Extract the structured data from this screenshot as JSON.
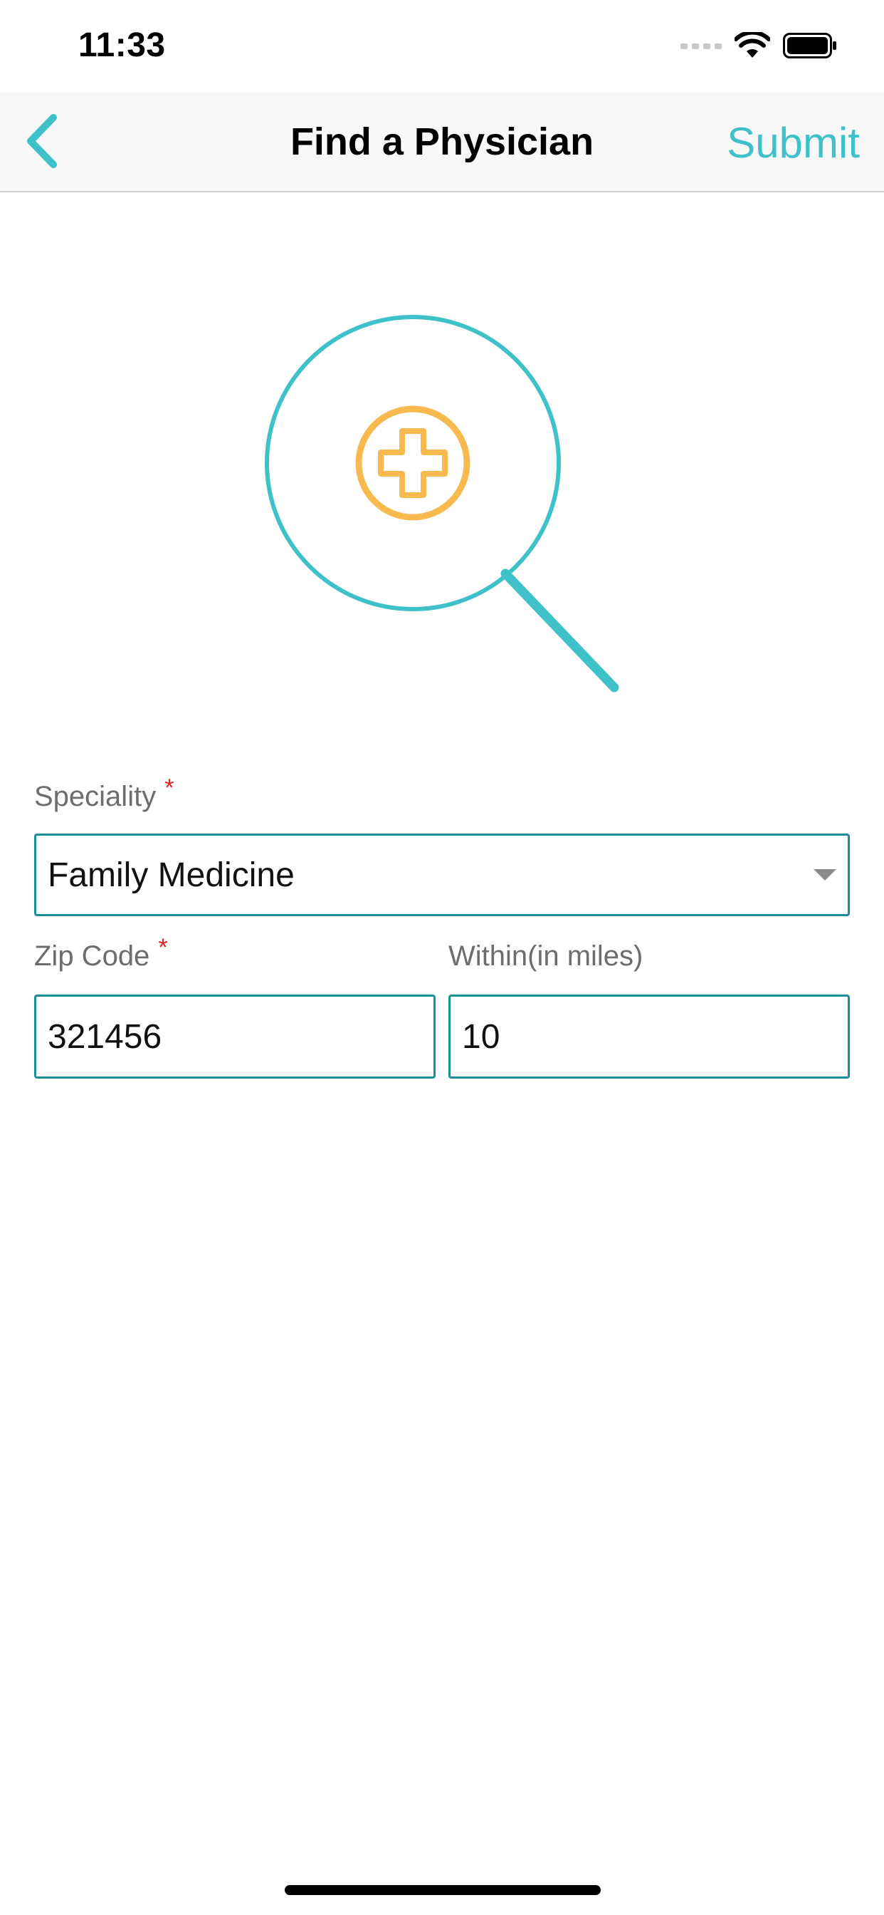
{
  "status_bar": {
    "time": "11:33"
  },
  "nav": {
    "title": "Find a Physician",
    "submit_label": "Submit",
    "back_icon": "chevron-left-icon"
  },
  "illustration": {
    "icon": "search-plus-medical-icon"
  },
  "form": {
    "speciality": {
      "label": "Speciality",
      "required_mark": "*",
      "value": "Family Medicine"
    },
    "zip_code": {
      "label": "Zip Code",
      "required_mark": "*",
      "value": "321456"
    },
    "within": {
      "label": "Within(in miles)",
      "value": "10"
    }
  },
  "colors": {
    "accent": "#3fc1ca",
    "field_border": "#1b8f97",
    "medical_orange": "#f7b23b",
    "required": "#e02020"
  }
}
